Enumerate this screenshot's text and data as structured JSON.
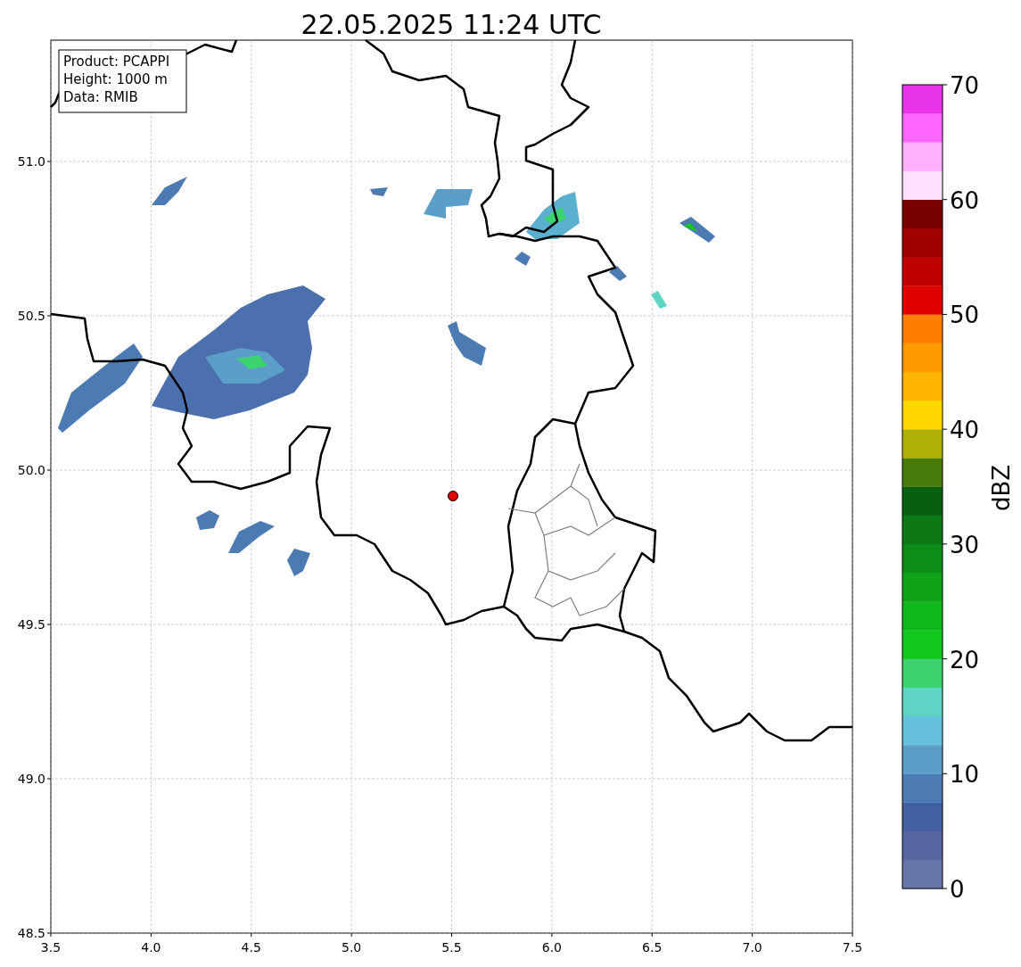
{
  "title": "22.05.2025 11:24 UTC",
  "info_box": [
    "Product: PCAPPI",
    "Height: 1000 m",
    "Data: RMIB"
  ],
  "x_ticks": [
    "3.5",
    "4.0",
    "4.5",
    "5.0",
    "5.5",
    "6.0",
    "6.5",
    "7.0",
    "7.5"
  ],
  "y_ticks": [
    "51.0",
    "50.5",
    "50.0",
    "49.5",
    "49.0",
    "48.5"
  ],
  "colorbar": {
    "label": "dBZ",
    "ticks": [
      "70",
      "60",
      "50",
      "40",
      "30",
      "20",
      "10",
      "0"
    ],
    "bins": [
      {
        "color": "#6675a8"
      },
      {
        "color": "#5566a0"
      },
      {
        "color": "#435ea1"
      },
      {
        "color": "#4c7ab2"
      },
      {
        "color": "#5b9ec8"
      },
      {
        "color": "#66c1de"
      },
      {
        "color": "#5fd4c4"
      },
      {
        "color": "#3cd46e"
      },
      {
        "color": "#10c81e"
      },
      {
        "color": "#0fb81a"
      },
      {
        "color": "#0fa31a"
      },
      {
        "color": "#0d8d17"
      },
      {
        "color": "#0c7915"
      },
      {
        "color": "#085f0f"
      },
      {
        "color": "#477b0a"
      },
      {
        "color": "#aeb005"
      },
      {
        "color": "#ffd700"
      },
      {
        "color": "#ffb400"
      },
      {
        "color": "#ff9a00"
      },
      {
        "color": "#ff7d00"
      },
      {
        "color": "#e00000"
      },
      {
        "color": "#c00000"
      },
      {
        "color": "#a00000"
      },
      {
        "color": "#780000"
      },
      {
        "color": "#ffe0ff"
      },
      {
        "color": "#ffb0ff"
      },
      {
        "color": "#ff66ff"
      },
      {
        "color": "#e833ea"
      }
    ]
  }
}
